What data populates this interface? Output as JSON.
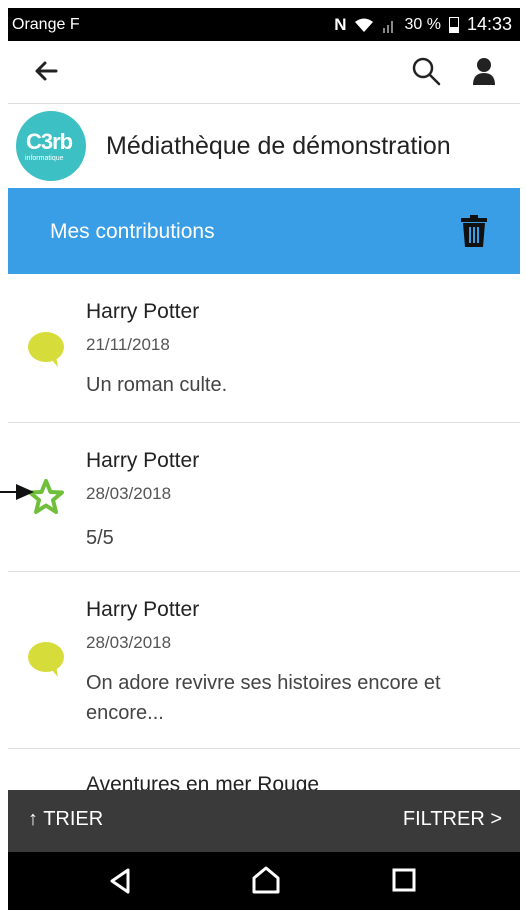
{
  "status": {
    "carrier": "Orange F",
    "nfc": "N",
    "battery_percent": "30 %",
    "time": "14:33"
  },
  "appbar": {
    "icons": [
      "back-arrow-icon",
      "search-icon",
      "account-icon"
    ]
  },
  "library": {
    "logo_text": "C3rb",
    "logo_subtext": "informatique",
    "name": "Médiathèque de démonstration"
  },
  "section": {
    "title": "Mes contributions",
    "action_icon": "trash-icon"
  },
  "contributions": [
    {
      "type": "comment",
      "icon": "comment-bubble-icon",
      "title": "Harry Potter",
      "date": "21/11/2018",
      "content": "Un roman culte."
    },
    {
      "type": "rating",
      "icon": "star-icon",
      "title": "Harry Potter",
      "date": "28/03/2018",
      "content": "5/5"
    },
    {
      "type": "comment",
      "icon": "comment-bubble-icon",
      "title": "Harry Potter",
      "date": "28/03/2018",
      "content": "On adore revivre ses histoires encore et encore..."
    },
    {
      "type": "comment",
      "title": "Aventures en mer Rouge"
    }
  ],
  "bottombar": {
    "sort_label": "↑ TRIER",
    "filter_label": "FILTRER >"
  },
  "colors": {
    "accent_blue": "#3a9ee6",
    "logo_teal": "#3cc0c4",
    "comment_yellow": "#d6dc3a",
    "star_green": "#6fbf3a",
    "bottom_bar": "#3a3a3a"
  }
}
